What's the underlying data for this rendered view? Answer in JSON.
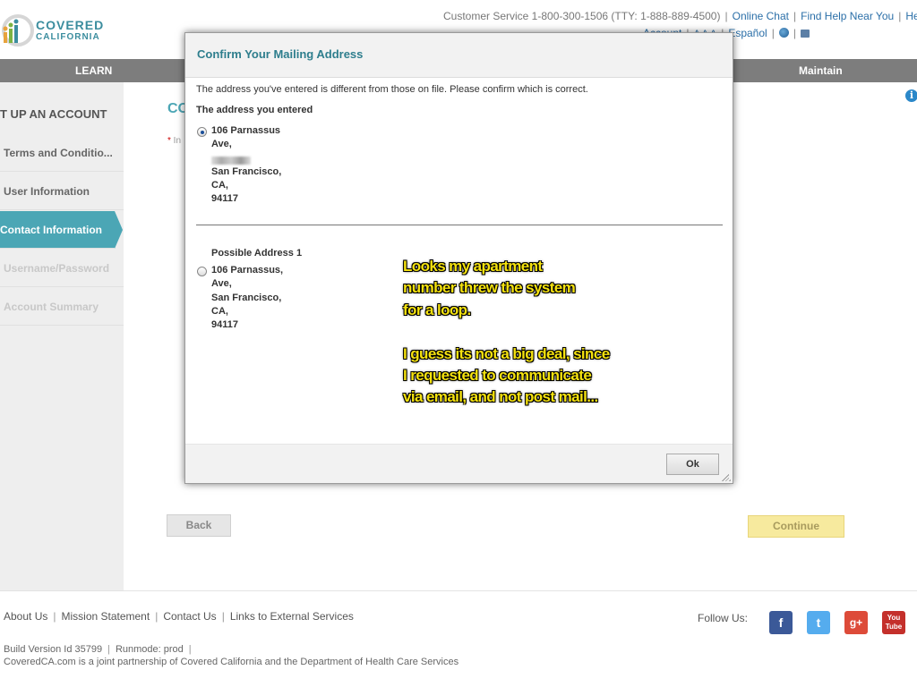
{
  "logo": {
    "line1": "COVERED",
    "line2": "CALIFORNIA"
  },
  "header": {
    "customer_service": "Customer Service 1-800-300-1506 (TTY: 1-888-889-4500)",
    "online_chat": "Online Chat",
    "find_help": "Find Help Near You",
    "help": "Help",
    "account": "Account",
    "text_size": "A A A",
    "espanol": "Español"
  },
  "nav": {
    "learn": "LEARN",
    "maintain": "Maintain"
  },
  "sidebar": {
    "title": "T UP AN ACCOUNT",
    "items": [
      {
        "label": "Terms and Conditio...",
        "state": "done"
      },
      {
        "label": "User Information",
        "state": "done"
      },
      {
        "label": "Contact Information",
        "state": "active"
      },
      {
        "label": "Username/Password",
        "state": "todo"
      },
      {
        "label": "Account Summary",
        "state": "todo"
      }
    ]
  },
  "main": {
    "heading": "CO",
    "required_note": "In"
  },
  "buttons": {
    "back": "Back",
    "continue": "Continue"
  },
  "modal": {
    "title": "Confirm Your Mailing Address",
    "message": "The address you've entered is different from those on file. Please confirm which is correct.",
    "entered_label": "The address you entered",
    "entered_address": [
      "106 Parnassus",
      "Ave,",
      "",
      "San Francisco,",
      "CA,",
      "94117"
    ],
    "possible_label": "Possible Address 1",
    "possible_address": [
      "106 Parnassus,",
      "Ave,",
      "San Francisco,",
      "CA,",
      "94117"
    ],
    "ok": "Ok"
  },
  "annotation": "Looks my apartment\nnumber threw the system\nfor a loop.\n\nI guess its not a big deal, since\nI requested to communicate\nvia email, and not post mail...",
  "footer": {
    "links": [
      "About Us",
      "Mission Statement",
      "Contact Us",
      "Links to External Services"
    ],
    "follow_us": "Follow Us:",
    "social": [
      "f",
      "t",
      "g+",
      "You Tube"
    ],
    "build_version": "Build Version Id 35799",
    "runmode": "Runmode: prod",
    "partnership": "CoveredCA.com is a joint partnership of Covered California and the Department of Health Care Services"
  },
  "colors": {
    "teal": "#4ba6b5",
    "nav_gray": "#7d7d7d",
    "annotation_yellow": "#f5e20f",
    "continue_yellow": "#f7ea9e"
  },
  "icons": [
    "logo-icon",
    "info-icon",
    "globe-icon",
    "print-icon",
    "facebook-icon",
    "twitter-icon",
    "google-plus-icon",
    "youtube-icon"
  ]
}
